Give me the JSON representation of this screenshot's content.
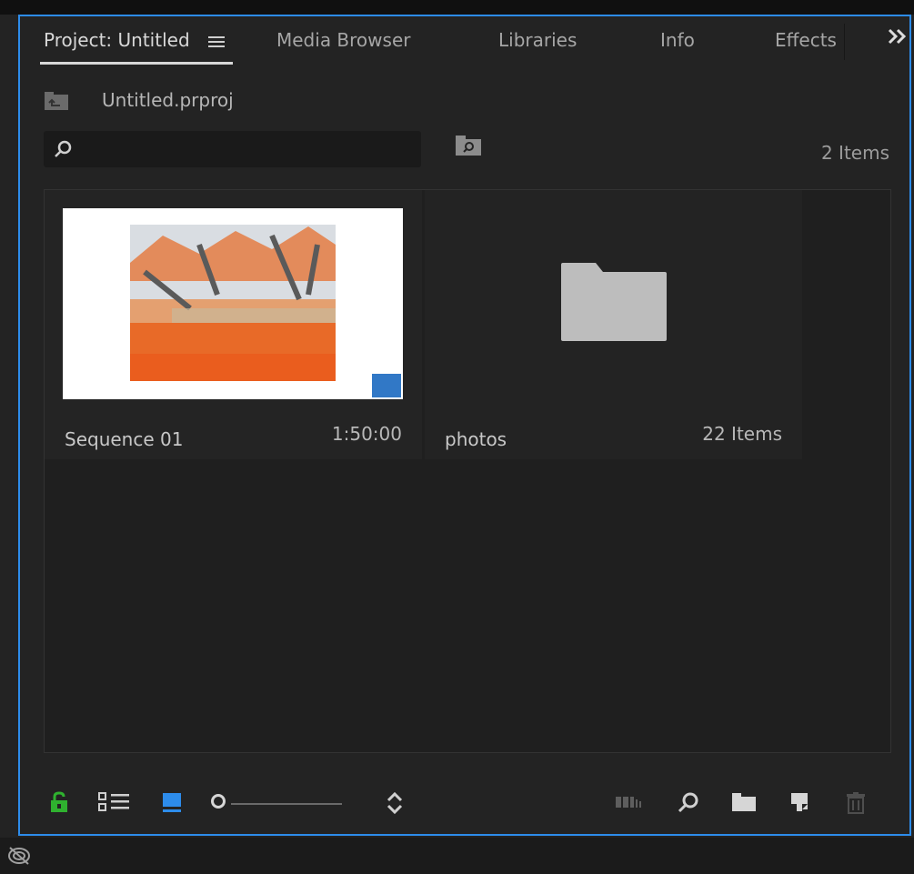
{
  "tabs": [
    {
      "label": "Project: Untitled",
      "active": true
    },
    {
      "label": "Media Browser",
      "active": false
    },
    {
      "label": "Libraries",
      "active": false
    },
    {
      "label": "Info",
      "active": false
    },
    {
      "label": "Effects",
      "active": false
    }
  ],
  "tab_menu_icon": "hamburger-icon",
  "overflow_icon": "double-chevron-right-icon",
  "project": {
    "file_name": "Untitled.prproj",
    "item_count": "2 Items"
  },
  "search": {
    "value": "",
    "placeholder": ""
  },
  "items": [
    {
      "name": "Sequence 01",
      "meta": "1:50:00",
      "kind": "sequence"
    },
    {
      "name": "photos",
      "meta": "22 Items",
      "kind": "bin"
    }
  ],
  "colors": {
    "panel_border": "#2d8ceb",
    "lock_green": "#2fb12f",
    "icon_view_blue": "#2d8ceb",
    "background": "#232323"
  },
  "bottom_toolbar": {
    "zoom_level": 0
  }
}
